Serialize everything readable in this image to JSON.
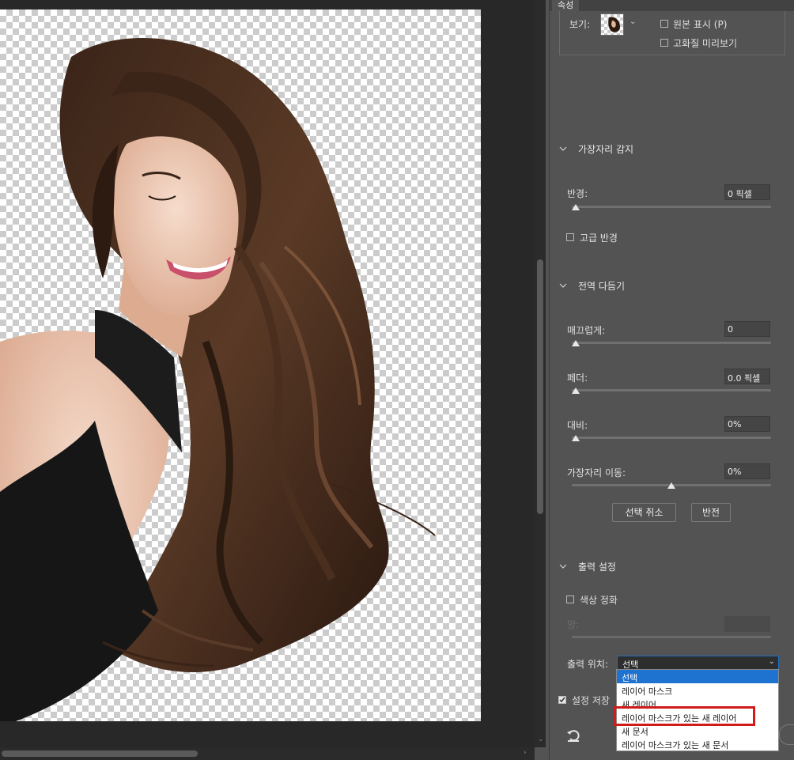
{
  "panel": {
    "tab_label": "속성",
    "view": {
      "label": "보기:",
      "show_original": "원본 표시 (P)",
      "high_quality_preview": "고화질 미리보기"
    },
    "edge_detection": {
      "title": "가장자리 감지",
      "radius_label": "반경:",
      "radius_value": "0 픽셀",
      "radius_level": 0,
      "smart_radius": "고급 반경"
    },
    "global_refinements": {
      "title": "전역 다듬기",
      "smooth_label": "매끄럽게:",
      "smooth_value": "0",
      "smooth_level": 0,
      "feather_label": "페더:",
      "feather_value": "0.0 픽셀",
      "feather_level": 0,
      "contrast_label": "대비:",
      "contrast_value": "0%",
      "contrast_level": 0,
      "shift_edge_label": "가장자리 이동:",
      "shift_edge_value": "0%",
      "shift_edge_level": 0.5,
      "clear_selection": "선택 취소",
      "invert": "반전"
    },
    "output_settings": {
      "title": "출력 설정",
      "decontaminate": "색상 정화",
      "amount_label": "양:",
      "output_to_label": "출력 위치:",
      "output_to_value": "선택",
      "remember_settings": "설정 저장",
      "options": [
        "선택",
        "레이어 마스크",
        "새 레이어",
        "레이어 마스크가 있는 새 레이어",
        "새 문서",
        "레이어 마스크가 있는 새 문서"
      ]
    }
  },
  "colors": {
    "panel_bg": "#535353",
    "canvas_bg": "#282828",
    "accent": "#1e72d0",
    "highlight": "#d11a1a"
  },
  "icons": [
    "chevron-down-icon",
    "reset-icon",
    "checkbox"
  ]
}
